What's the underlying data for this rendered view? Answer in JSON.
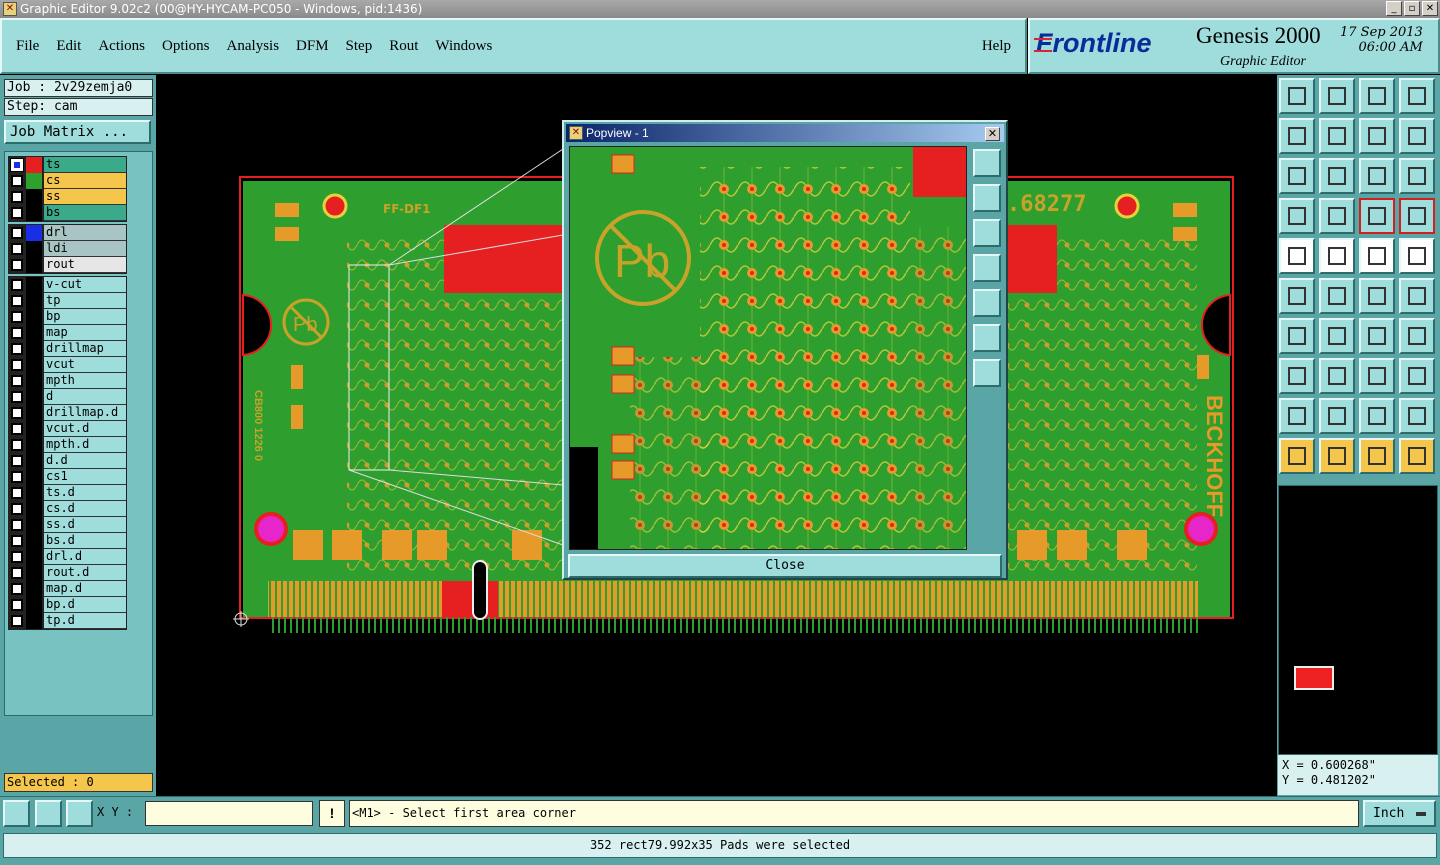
{
  "window": {
    "title": "Graphic Editor 9.02c2 (00@HY-HYCAM-PC050 - Windows, pid:1436)",
    "controls": [
      "_",
      "▫",
      "✕"
    ]
  },
  "menu": {
    "items": [
      "File",
      "Edit",
      "Actions",
      "Options",
      "Analysis",
      "DFM",
      "Step",
      "Rout",
      "Windows"
    ],
    "help": "Help"
  },
  "brand": {
    "logo": "Frontline",
    "product": "Genesis 2000",
    "subtitle": "Graphic Editor",
    "date": "17 Sep 2013",
    "time": "06:00 AM"
  },
  "job": {
    "job_line": "Job : 2v29zemja0",
    "step_line": "Step: cam",
    "matrix_button": "Job Matrix ..."
  },
  "layers": {
    "group1": [
      {
        "name": "ts",
        "color": "#e62020",
        "bg": "#3aaa8a",
        "checked": true
      },
      {
        "name": "cs",
        "color": "#2ea02e",
        "bg": "#f4c64c",
        "checked": false
      },
      {
        "name": "ss",
        "color": "#000000",
        "bg": "#f4c64c",
        "checked": false
      },
      {
        "name": "bs",
        "color": "#000000",
        "bg": "#3aaa8a",
        "checked": false
      }
    ],
    "group2": [
      {
        "name": "drl",
        "color": "#1a2ee6",
        "bg": "#a9c4c4",
        "checked": false
      },
      {
        "name": "ldi",
        "color": "#000000",
        "bg": "#a9c4c4",
        "checked": false
      },
      {
        "name": "rout",
        "color": "#000000",
        "bg": "#e6e6e6",
        "checked": false
      }
    ],
    "group3": [
      "v-cut",
      "tp",
      "bp",
      "map",
      "drillmap",
      "vcut",
      "mpth",
      "d",
      "drillmap.d",
      "vcut.d",
      "mpth.d",
      "d.d",
      "cs1",
      "ts.d",
      "cs.d",
      "ss.d",
      "bs.d",
      "drl.d",
      "rout.d",
      "map.d",
      "bp.d",
      "tp.d"
    ]
  },
  "selected_label": "Selected : 0",
  "board": {
    "silk_left": "FF-DF1",
    "silk_number": ".68277",
    "silk_brand": "BECKHOFF",
    "silk_code": "CB800 1226 0",
    "pb_mark": "Pb"
  },
  "popview": {
    "title": "Popview - 1",
    "close_label": "Close",
    "pb_mark": "Pb"
  },
  "coords": {
    "x": "X = 0.600268\"",
    "y": "Y = 0.481202\""
  },
  "bottom": {
    "xy_label": "X Y :",
    "xy_value": "",
    "warn": "!",
    "prompt": "<M1> - Select first area corner",
    "unit": "Inch"
  },
  "status": {
    "message": "352 rect79.992x35 Pads were selected"
  },
  "colors": {
    "board_green": "#2e9e2e",
    "copper_red": "#e62020",
    "pad_orange": "#e69a2a",
    "panel_teal": "#5aa6a6",
    "button_teal": "#9fdcdc"
  }
}
